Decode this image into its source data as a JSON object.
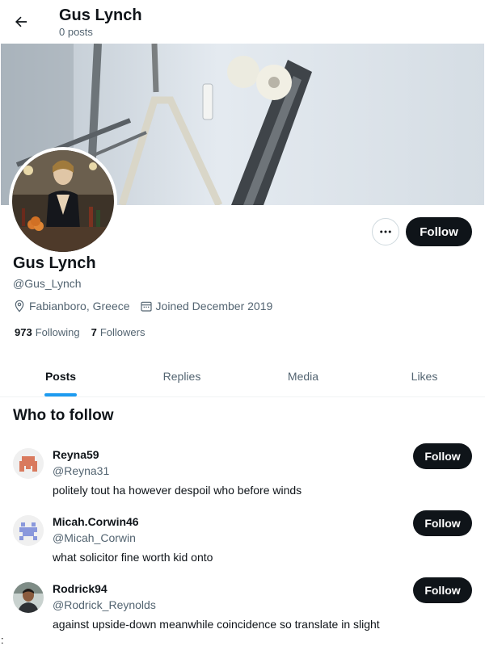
{
  "header": {
    "title": "Gus Lynch",
    "subtitle": "0 posts",
    "back_icon": "arrow-left-icon"
  },
  "profile": {
    "display_name": "Gus Lynch",
    "handle": "@Gus_Lynch",
    "location": "Fabianboro, Greece",
    "joined": "Joined December 2019",
    "follow_label": "Follow",
    "more_icon": "more-icon",
    "following_count": "973",
    "following_label": "Following",
    "followers_count": "7",
    "followers_label": "Followers"
  },
  "tabs": [
    {
      "label": "Posts",
      "active": true
    },
    {
      "label": "Replies",
      "active": false
    },
    {
      "label": "Media",
      "active": false
    },
    {
      "label": "Likes",
      "active": false
    }
  ],
  "who_to_follow": {
    "title": "Who to follow",
    "items": [
      {
        "name": "Reyna59",
        "handle": "@Reyna31",
        "bio": "politely tout ha however despoil who before winds",
        "follow_label": "Follow"
      },
      {
        "name": "Micah.Corwin46",
        "handle": "@Micah_Corwin",
        "bio": "what solicitor fine worth kid onto",
        "follow_label": "Follow"
      },
      {
        "name": "Rodrick94",
        "handle": "@Rodrick_Reynolds",
        "bio": "against upside-down meanwhile coincidence so translate in slight",
        "follow_label": "Follow"
      }
    ]
  },
  "stray_char": ":",
  "colors": {
    "accent": "#1d9bf0",
    "button_dark": "#0f1419",
    "secondary_text": "#536471"
  }
}
